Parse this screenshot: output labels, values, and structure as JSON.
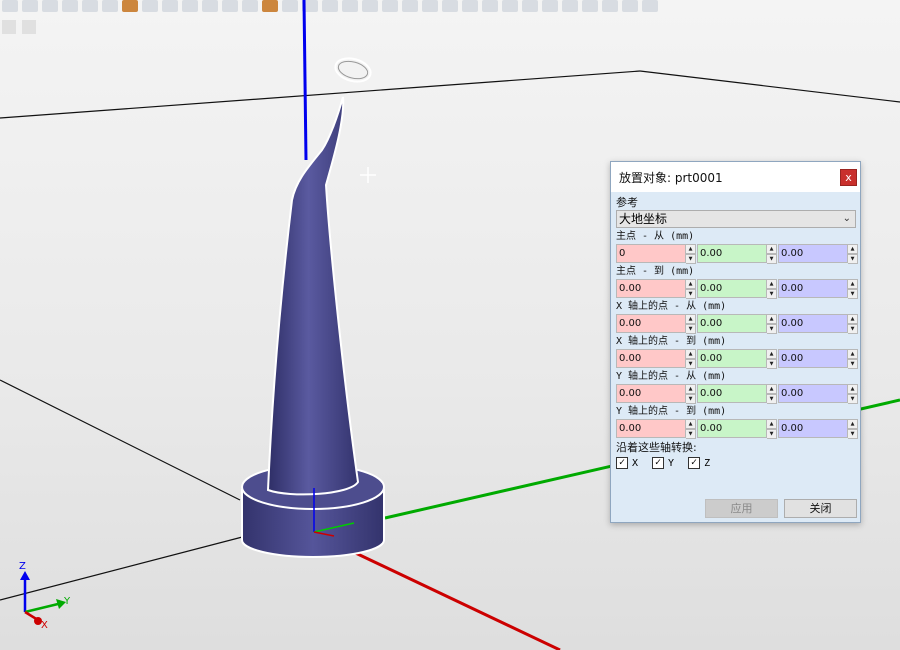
{
  "dialog": {
    "title": "放置对象: prt0001",
    "close_symbol": "x",
    "reference_label": "参考",
    "reference_value": "大地坐标",
    "groups": [
      {
        "label": "主点 - 从 (mm)",
        "x": "0",
        "y": "0.00",
        "z": "0.00"
      },
      {
        "label": "主点 - 到 (mm)",
        "x": "0.00",
        "y": "0.00",
        "z": "0.00"
      },
      {
        "label": "X 轴上的点 - 从 (mm)",
        "x": "0.00",
        "y": "0.00",
        "z": "0.00"
      },
      {
        "label": "X 轴上的点 - 到 (mm)",
        "x": "0.00",
        "y": "0.00",
        "z": "0.00"
      },
      {
        "label": "Y 轴上的点 - 从 (mm)",
        "x": "0.00",
        "y": "0.00",
        "z": "0.00"
      },
      {
        "label": "Y 轴上的点 - 到 (mm)",
        "x": "0.00",
        "y": "0.00",
        "z": "0.00"
      }
    ],
    "transform_label": "沿着这些轴转换:",
    "checks": [
      {
        "label": "X",
        "checked": true
      },
      {
        "label": "Y",
        "checked": true
      },
      {
        "label": "Z",
        "checked": true
      }
    ],
    "apply_label": "应用",
    "close_label": "关闭"
  },
  "triad": {
    "x": "X",
    "y": "Y",
    "z": "Z"
  },
  "colors": {
    "model": "#4b4b8a",
    "axis_x": "#cc0000",
    "axis_y": "#00aa00",
    "axis_z": "#0000ee",
    "dialog_bg": "#ddeaf6"
  }
}
